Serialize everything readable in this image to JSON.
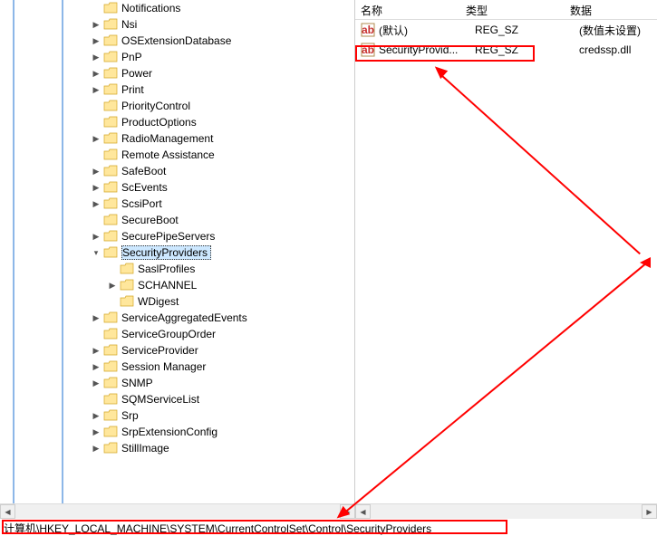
{
  "tree": {
    "items": [
      {
        "label": "Notifications",
        "expand": ""
      },
      {
        "label": "Nsi",
        "expand": ">"
      },
      {
        "label": "OSExtensionDatabase",
        "expand": ">"
      },
      {
        "label": "PnP",
        "expand": ">"
      },
      {
        "label": "Power",
        "expand": ">"
      },
      {
        "label": "Print",
        "expand": ">"
      },
      {
        "label": "PriorityControl",
        "expand": ""
      },
      {
        "label": "ProductOptions",
        "expand": ""
      },
      {
        "label": "RadioManagement",
        "expand": ">"
      },
      {
        "label": "Remote Assistance",
        "expand": ""
      },
      {
        "label": "SafeBoot",
        "expand": ">"
      },
      {
        "label": "ScEvents",
        "expand": ">"
      },
      {
        "label": "ScsiPort",
        "expand": ">"
      },
      {
        "label": "SecureBoot",
        "expand": ""
      },
      {
        "label": "SecurePipeServers",
        "expand": ">"
      },
      {
        "label": "SecurityProviders",
        "expand": "v",
        "selected": true,
        "children": [
          {
            "label": "SaslProfiles",
            "expand": ""
          },
          {
            "label": "SCHANNEL",
            "expand": ">"
          },
          {
            "label": "WDigest",
            "expand": ""
          }
        ]
      },
      {
        "label": "ServiceAggregatedEvents",
        "expand": ">"
      },
      {
        "label": "ServiceGroupOrder",
        "expand": ""
      },
      {
        "label": "ServiceProvider",
        "expand": ">"
      },
      {
        "label": "Session Manager",
        "expand": ">"
      },
      {
        "label": "SNMP",
        "expand": ">"
      },
      {
        "label": "SQMServiceList",
        "expand": ""
      },
      {
        "label": "Srp",
        "expand": ">"
      },
      {
        "label": "SrpExtensionConfig",
        "expand": ">"
      },
      {
        "label": "StillImage",
        "expand": ">"
      }
    ]
  },
  "list": {
    "headers": {
      "name": "名称",
      "type": "类型",
      "data": "数据"
    },
    "rows": [
      {
        "name": "(默认)",
        "type": "REG_SZ",
        "data": "(数值未设置)"
      },
      {
        "name": "SecurityProvid...",
        "type": "REG_SZ",
        "data": "credssp.dll"
      }
    ]
  },
  "path": "计算机\\HKEY_LOCAL_MACHINE\\SYSTEM\\CurrentControlSet\\Control\\SecurityProviders",
  "_annotations": "red boxes and arrows are tutorial overlays, not original UI"
}
